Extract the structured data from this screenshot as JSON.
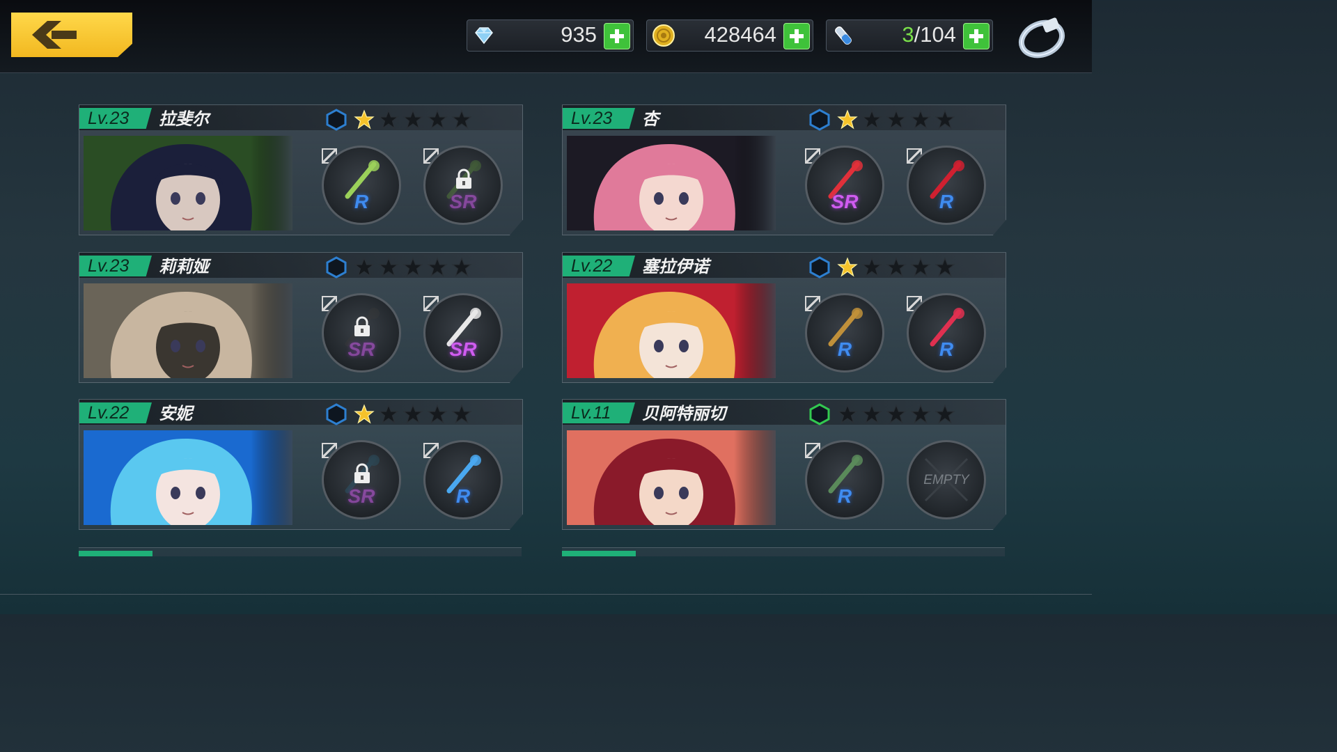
{
  "topbar": {
    "back_button": "back",
    "resources": [
      {
        "id": "gems",
        "icon": "gem-icon",
        "value": "935"
      },
      {
        "id": "gold",
        "icon": "gold-coin-icon",
        "value": "428464"
      },
      {
        "id": "stamina",
        "icon": "vial-icon",
        "current": "3",
        "max": "/104"
      }
    ],
    "ring_icon": "ring-icon"
  },
  "colors": {
    "accent_green": "#1fb078",
    "sr": "#d05cf0",
    "r": "#3f8cf0",
    "star_gold": "#f5c22a",
    "back_yellow": "#f2b820"
  },
  "characters": [
    {
      "level": "Lv.23",
      "name": "拉斐尔",
      "hex_color": "#2d7fd0",
      "stars": 1,
      "portrait_palette": [
        "#2a4d24",
        "#1b1f3a",
        "#d8c8c0"
      ],
      "weapons": [
        {
          "rarity": "R",
          "locked": false,
          "item": "flower-staff-icon",
          "color": "#9bd05a"
        },
        {
          "rarity": "SR",
          "locked": true,
          "item": "chain-icon",
          "color": "#5a8a3a"
        }
      ]
    },
    {
      "level": "Lv.23",
      "name": "杏",
      "hex_color": "#2d7fd0",
      "stars": 1,
      "portrait_palette": [
        "#1c1a24",
        "#e07a9a",
        "#f4d8d0"
      ],
      "weapons": [
        {
          "rarity": "SR",
          "locked": false,
          "item": "wrench-icon",
          "color": "#e0303a"
        },
        {
          "rarity": "R",
          "locked": false,
          "item": "hook-staff-icon",
          "color": "#d02030"
        }
      ]
    },
    {
      "level": "Lv.23",
      "name": "莉莉娅",
      "hex_color": "#2d7fd0",
      "stars": 0,
      "portrait_palette": [
        "#6a6458",
        "#c8b6a0",
        "#3a3630"
      ],
      "weapons": [
        {
          "rarity": "SR",
          "locked": true,
          "item": "gauntlet-icon",
          "color": "#3a3a3a"
        },
        {
          "rarity": "SR",
          "locked": false,
          "item": "spiked-blade-icon",
          "color": "#e8e8e8"
        }
      ]
    },
    {
      "level": "Lv.22",
      "name": "塞拉伊诺",
      "hex_color": "#2d7fd0",
      "stars": 1,
      "portrait_palette": [
        "#c02030",
        "#f0b050",
        "#f4e4d8"
      ],
      "weapons": [
        {
          "rarity": "R",
          "locked": false,
          "item": "ornate-sword-icon",
          "color": "#c0903a"
        },
        {
          "rarity": "R",
          "locked": false,
          "item": "red-blade-icon",
          "color": "#e03050"
        }
      ]
    },
    {
      "level": "Lv.22",
      "name": "安妮",
      "hex_color": "#2d7fd0",
      "stars": 1,
      "portrait_palette": [
        "#1a6ad0",
        "#5ac8f0",
        "#f4e4e0"
      ],
      "weapons": [
        {
          "rarity": "SR",
          "locked": true,
          "item": "cannon-icon",
          "color": "#2a5a70"
        },
        {
          "rarity": "R",
          "locked": false,
          "item": "key-staff-icon",
          "color": "#4aa8f0"
        }
      ]
    },
    {
      "level": "Lv.11",
      "name": "贝阿特丽切",
      "hex_color": "#32c850",
      "stars": 0,
      "portrait_palette": [
        "#e07060",
        "#8a1a2a",
        "#f4d8c8"
      ],
      "weapons": [
        {
          "rarity": "R",
          "locked": false,
          "item": "rapier-icon",
          "color": "#5a8a5a"
        },
        {
          "empty": true,
          "label": "EMPTY"
        }
      ]
    }
  ]
}
